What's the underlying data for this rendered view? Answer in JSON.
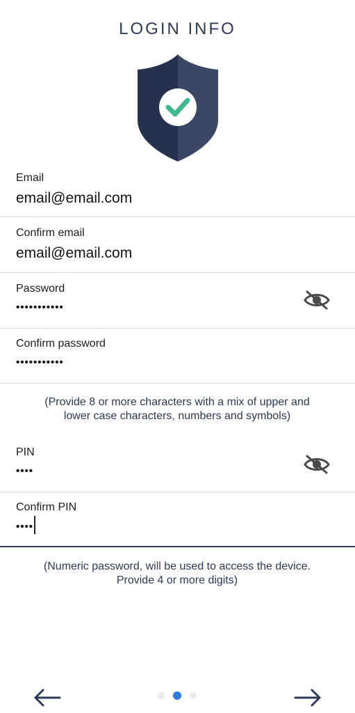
{
  "header": {
    "title": "LOGIN INFO"
  },
  "icons": {
    "shield": "shield-check-icon",
    "visibility": "eye-off-icon",
    "back": "arrow-left-icon",
    "next": "arrow-right-icon"
  },
  "colors": {
    "primary": "#2d3a55",
    "check": "#3fb98e",
    "page_indicator_active": "#2f7de1",
    "page_indicator_inactive": "#ececec"
  },
  "form": {
    "email": {
      "label": "Email",
      "value": "email@email.com"
    },
    "confirm_email": {
      "label": "Confirm email",
      "value": "email@email.com"
    },
    "password": {
      "label": "Password",
      "value": "•••••••••••"
    },
    "confirm_password": {
      "label": "Confirm password",
      "value": "•••••••••••"
    },
    "password_hint": "(Provide 8 or more characters with a mix of upper and lower case characters, numbers and symbols)",
    "pin": {
      "label": "PIN",
      "value": "••••"
    },
    "confirm_pin": {
      "label": "Confirm PIN",
      "value": "••••"
    },
    "pin_hint": "(Numeric password, will be used to access the device. Provide 4 or more digits)"
  },
  "pagination": {
    "total": 3,
    "current": 2
  }
}
